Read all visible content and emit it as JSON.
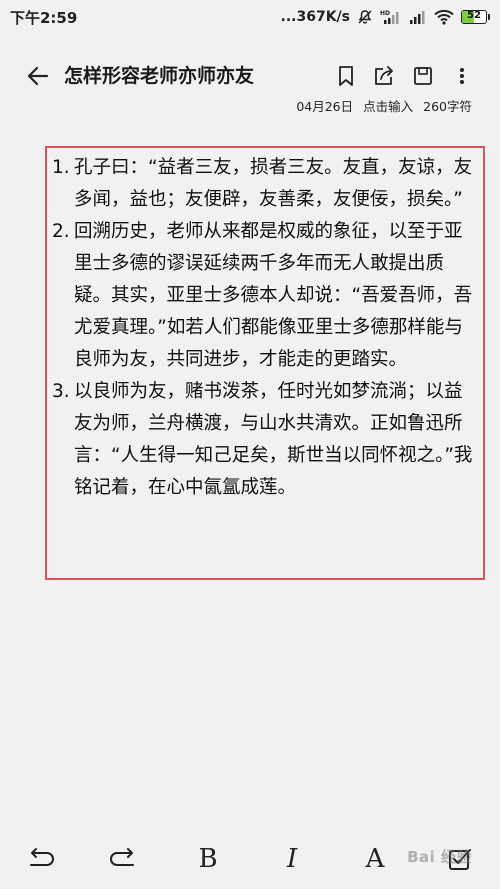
{
  "status_bar": {
    "time": "下午2:59",
    "network_speed": "...367K/s",
    "battery_level": "52"
  },
  "header": {
    "title": "怎样形容老师亦师亦友",
    "date": "04月26日",
    "input_hint": "点击输入",
    "char_count": "260字符"
  },
  "note": {
    "items": [
      {
        "number": "1.",
        "text": "孔子曰：“益者三友，损者三友。友直，友谅，友多闻，益也；友便辟，友善柔，友便佞，损矣。”"
      },
      {
        "number": "2.",
        "text": "回溯历史，老师从来都是权威的象征，以至于亚里士多德的谬误延续两千多年而无人敢提出质疑。其实，亚里士多德本人却说：“吾爱吾师，吾尤爱真理。”如若人们都能像亚里士多德那样能与良师为友，共同进步，才能走的更踏实。"
      },
      {
        "number": "3.",
        "text": "以良师为友，赌书泼茶，任时光如梦流淌；以益友为师，兰舟横渡，与山水共清欢。正如鲁迅所言：“人生得一知己足矣，斯世当以同怀视之。”我铭记着，在心中氤氲成莲。"
      }
    ]
  },
  "bottom_toolbar": {
    "bold_label": "B",
    "italic_label": "I",
    "font_label": "A"
  },
  "watermark": "Bai 经验",
  "colors": {
    "frame": "#d9545a",
    "background": "#f1f1f1",
    "battery_fill": "#7ccf44"
  }
}
